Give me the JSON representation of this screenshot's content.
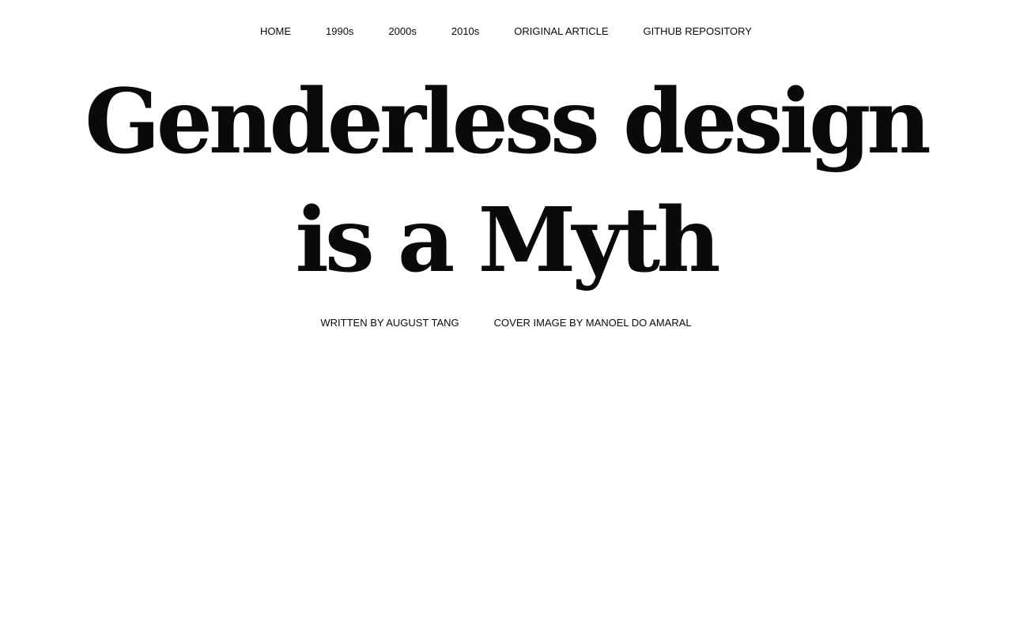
{
  "nav": {
    "items": [
      {
        "label": "HOME"
      },
      {
        "label": "1990s"
      },
      {
        "label": "2000s"
      },
      {
        "label": "2010s"
      },
      {
        "label": "ORIGINAL ARTICLE"
      },
      {
        "label": "GITHUB REPOSITORY"
      }
    ]
  },
  "hero": {
    "title": "Genderless design is a Myth"
  },
  "credits": {
    "author": "WRITTEN BY AUGUST TANG",
    "cover": "COVER IMAGE BY MANOEL DO AMARAL"
  },
  "colors": {
    "text": "#0a0a0a",
    "background": "#ffffff"
  }
}
